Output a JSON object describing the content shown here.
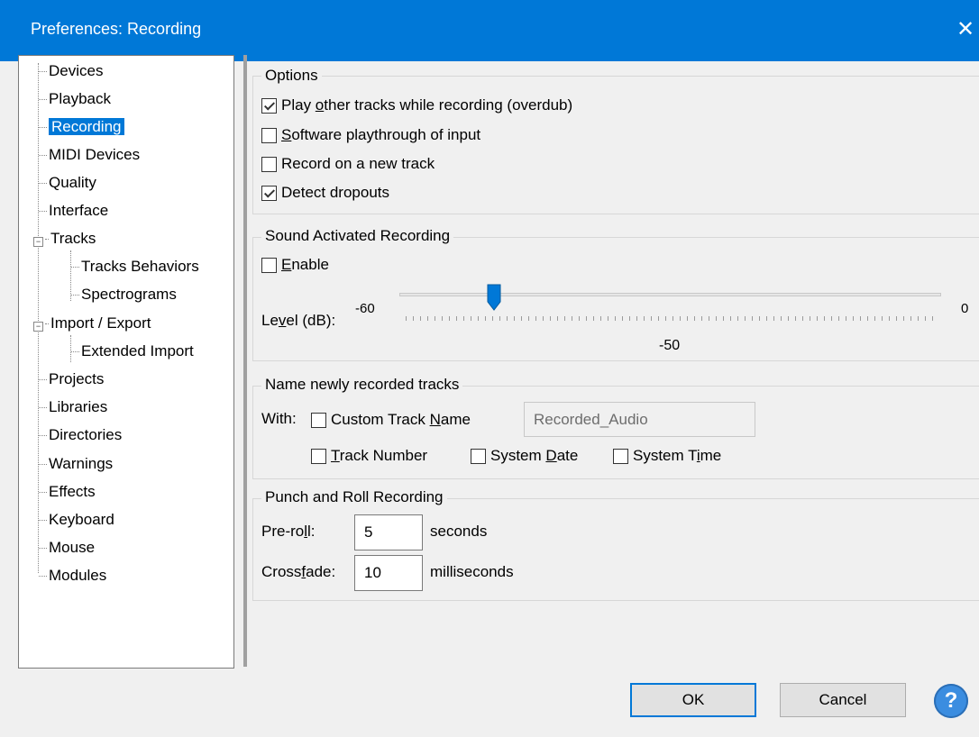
{
  "window": {
    "title": "Preferences: Recording",
    "close_glyph": "✕"
  },
  "tree": {
    "items": [
      {
        "label": "Devices"
      },
      {
        "label": "Playback"
      },
      {
        "label": "Recording"
      },
      {
        "label": "MIDI Devices"
      },
      {
        "label": "Quality"
      },
      {
        "label": "Interface"
      },
      {
        "label": "Tracks"
      },
      {
        "label": "Tracks Behaviors"
      },
      {
        "label": "Spectrograms"
      },
      {
        "label": "Import / Export"
      },
      {
        "label": "Extended Import"
      },
      {
        "label": "Projects"
      },
      {
        "label": "Libraries"
      },
      {
        "label": "Directories"
      },
      {
        "label": "Warnings"
      },
      {
        "label": "Effects"
      },
      {
        "label": "Keyboard"
      },
      {
        "label": "Mouse"
      },
      {
        "label": "Modules"
      }
    ],
    "selected": "Recording",
    "expander_glyph": "−"
  },
  "options": {
    "legend": "Options",
    "overdub": {
      "pre": "Play ",
      "ul": "o",
      "post": "ther tracks while recording (overdub)",
      "checked": true
    },
    "playthrough": {
      "pre": "",
      "ul": "S",
      "post": "oftware playthrough of input",
      "checked": false
    },
    "new_track": {
      "label": "Record on a new track",
      "checked": false
    },
    "dropouts": {
      "label": "Detect dropouts",
      "checked": true
    }
  },
  "sound_activated": {
    "legend": "Sound Activated Recording",
    "enable": {
      "pre": "",
      "ul": "E",
      "post": "nable",
      "checked": false
    },
    "level_label": {
      "pre": "Le",
      "ul": "v",
      "post": "el (dB):"
    },
    "min": "-60",
    "max": "0",
    "value": "-50",
    "value_fraction": 0.1667
  },
  "naming": {
    "legend": "Name newly recorded tracks",
    "with_label": "With:",
    "custom_name": {
      "pre": "Custom Track ",
      "ul": "N",
      "post": "ame",
      "checked": false
    },
    "custom_value": "Recorded_Audio",
    "track_number": {
      "pre": "",
      "ul": "T",
      "post": "rack Number",
      "checked": false
    },
    "system_date": {
      "pre": "System ",
      "ul": "D",
      "post": "ate",
      "checked": false
    },
    "system_time": {
      "pre": "System T",
      "ul": "i",
      "post": "me",
      "checked": false
    }
  },
  "punch_roll": {
    "legend": "Punch and Roll Recording",
    "preroll_label": {
      "pre": "Pre-ro",
      "ul": "l",
      "post": "l:"
    },
    "preroll_value": "5",
    "preroll_unit": "seconds",
    "crossfade_label": {
      "pre": "Cross",
      "ul": "f",
      "post": "ade:"
    },
    "crossfade_value": "10",
    "crossfade_unit": "milliseconds"
  },
  "buttons": {
    "ok": "OK",
    "cancel": "Cancel",
    "help": "?"
  },
  "colors": {
    "accent": "#0078d7",
    "help": "#3b8de0"
  }
}
